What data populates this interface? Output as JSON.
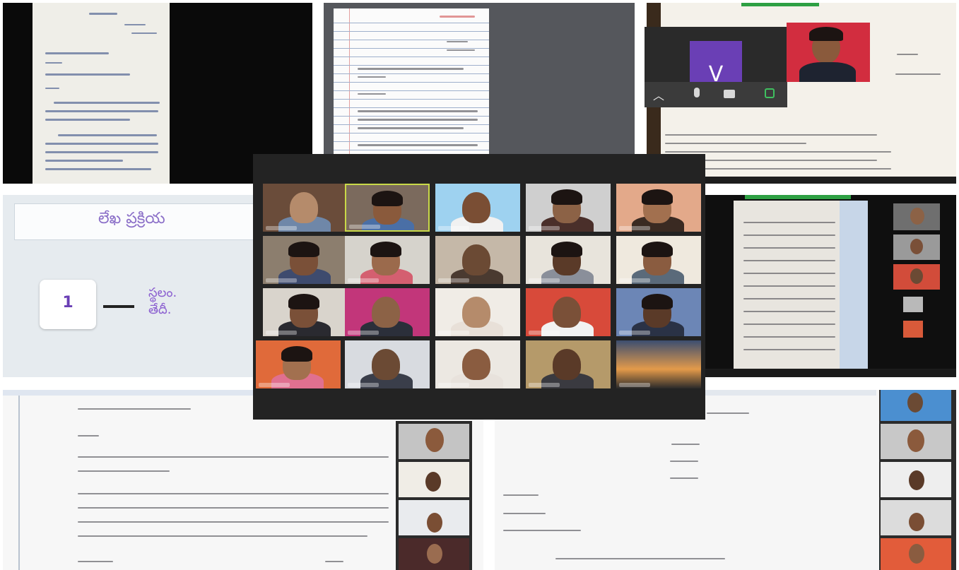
{
  "slide": {
    "title": "లేఖ ప్రక్రియ",
    "step_number": "1",
    "step_text_line1": "స్థలం.",
    "step_text_line2": "తేదీ."
  },
  "zoom_toolbar": {
    "avatar_letter": "V"
  },
  "colors": {
    "accent_purple": "#6a3fb5",
    "zoom_dark": "#232323",
    "active_speaker": "#c9d948",
    "slide_bg": "#e6ebef"
  },
  "icons": [
    "chevron-up-icon",
    "microphone-icon",
    "video-camera-icon",
    "share-screen-icon"
  ]
}
